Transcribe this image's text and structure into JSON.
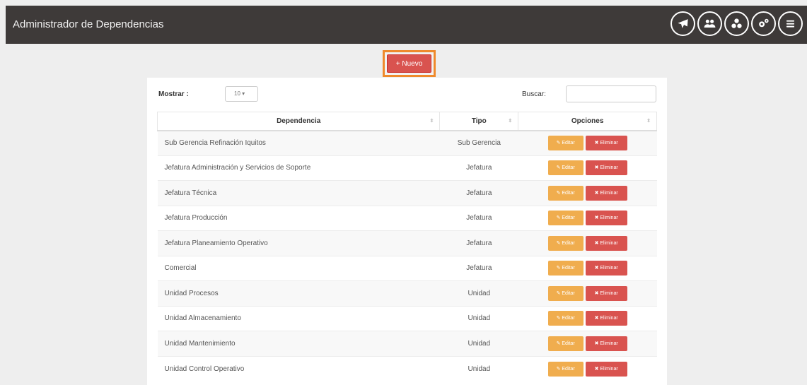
{
  "header": {
    "title": "Administrador de Dependencias"
  },
  "nav_icons": [
    {
      "name": "plane-icon"
    },
    {
      "name": "users-icon"
    },
    {
      "name": "biohazard-icon"
    },
    {
      "name": "cogs-icon"
    },
    {
      "name": "menu-icon"
    }
  ],
  "toolbar": {
    "new_label": "+ Nuevo"
  },
  "controls": {
    "show_label": "Mostrar :",
    "show_value": "10",
    "search_label": "Buscar:",
    "search_value": ""
  },
  "table": {
    "columns": [
      "Dependencia",
      "Tipo",
      "Opciones"
    ],
    "edit_label": "✎ Editar",
    "delete_label": "✖ Eliminar",
    "rows": [
      {
        "dependencia": "Sub Gerencia Refinación Iquitos",
        "tipo": "Sub Gerencia"
      },
      {
        "dependencia": "Jefatura Administración y Servicios de Soporte",
        "tipo": "Jefatura"
      },
      {
        "dependencia": "Jefatura Técnica",
        "tipo": "Jefatura"
      },
      {
        "dependencia": "Jefatura Producción",
        "tipo": "Jefatura"
      },
      {
        "dependencia": "Jefatura Planeamiento Operativo",
        "tipo": "Jefatura"
      },
      {
        "dependencia": "Comercial",
        "tipo": "Jefatura"
      },
      {
        "dependencia": "Unidad Procesos",
        "tipo": "Unidad"
      },
      {
        "dependencia": "Unidad Almacenamiento",
        "tipo": "Unidad"
      },
      {
        "dependencia": "Unidad Mantenimiento",
        "tipo": "Unidad"
      },
      {
        "dependencia": "Unidad Control Operativo",
        "tipo": "Unidad"
      }
    ]
  },
  "colors": {
    "topbar": "#3e3a39",
    "primary_red": "#d9534f",
    "warning_orange": "#f0ad4e",
    "highlight_orange": "#ef8a2c"
  }
}
